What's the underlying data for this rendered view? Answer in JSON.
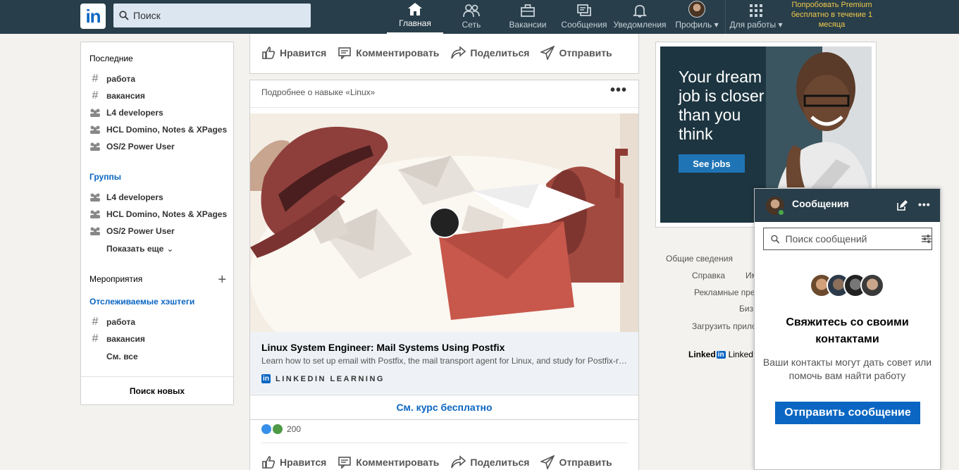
{
  "topnav": {
    "logo": "in",
    "search_placeholder": "Поиск",
    "items": [
      {
        "label": "Главная",
        "icon": "home-icon"
      },
      {
        "label": "Сеть",
        "icon": "network-icon"
      },
      {
        "label": "Вакансии",
        "icon": "briefcase-icon"
      },
      {
        "label": "Сообщения",
        "icon": "messaging-icon"
      },
      {
        "label": "Уведомления",
        "icon": "bell-icon"
      },
      {
        "label": "Профиль",
        "icon": "avatar"
      },
      {
        "label": "Для работы",
        "icon": "grid-icon"
      }
    ],
    "premium": "Попробовать Premium бесплатно в течение 1 месяца"
  },
  "sidebar": {
    "recent_heading": "Последние",
    "recent": [
      {
        "label": "работа",
        "icon": "hashtag-icon"
      },
      {
        "label": "вакансия",
        "icon": "hashtag-icon"
      },
      {
        "label": "L4 developers",
        "icon": "group-icon"
      },
      {
        "label": "HCL Domino, Notes & XPages",
        "icon": "group-icon"
      },
      {
        "label": "OS/2 Power User",
        "icon": "group-icon"
      }
    ],
    "groups_heading": "Группы",
    "groups": [
      {
        "label": "L4 developers",
        "icon": "group-icon"
      },
      {
        "label": "HCL Domino, Notes & XPages",
        "icon": "group-icon"
      },
      {
        "label": "OS/2 Power User",
        "icon": "group-icon"
      }
    ],
    "show_more": "Показать еще",
    "events_heading": "Мероприятия",
    "hashtags_heading": "Отслеживаемые хэштеги",
    "hashtags": [
      {
        "label": "работа",
        "icon": "hashtag-icon"
      },
      {
        "label": "вакансия",
        "icon": "hashtag-icon"
      }
    ],
    "see_all": "См. все",
    "discover": "Поиск новых"
  },
  "feed": {
    "actions": [
      "Нравится",
      "Комментировать",
      "Поделиться",
      "Отправить"
    ],
    "post": {
      "header": "Подробнее о навыке «Linux»",
      "course_title": "Linux System Engineer: Mail Systems Using Postfix",
      "course_desc": "Learn how to set up email with Postfix, the mail transport agent for Linux, and study for Postfix-related certification exams.",
      "brand": "LINKEDIN LEARNING",
      "cta": "См. курс бесплатно",
      "reaction_count": "200"
    }
  },
  "ad": {
    "headline": "Your dream job is closer than you think",
    "button": "See jobs"
  },
  "footer": {
    "links": [
      "Общие сведения",
      "Справка",
      "Им",
      "Рекламные пре",
      "Биз",
      "Загрузить прило"
    ],
    "brand": "Linked",
    "brand_in": "in",
    "brand_tail": "Linked"
  },
  "messaging": {
    "title": "Сообщения",
    "search_placeholder": "Поиск сообщений",
    "heading": "Свяжитесь со своими контактами",
    "text": "Ваши контакты могут дать совет или помочь вам найти работу",
    "button": "Отправить сообщение"
  },
  "colors": {
    "nav_bg": "#283e4a",
    "brand_blue": "#0a66c2",
    "premium_gold": "#f0c84b"
  }
}
